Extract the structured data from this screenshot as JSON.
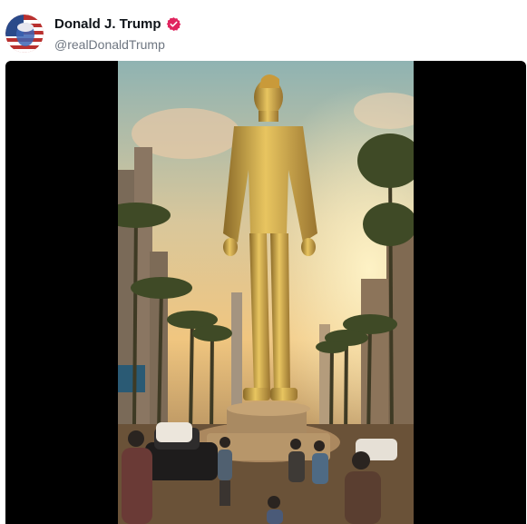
{
  "post": {
    "display_name": "Donald J. Trump",
    "handle": "@realDonaldTrump",
    "verified_icon": "verified-badge-icon",
    "avatar_icon": "avatar-flag-portrait"
  },
  "media": {
    "type": "video",
    "scene_icon": "golden-statue-video-frame"
  },
  "colors": {
    "verified": "#e0245e",
    "name": "#0f1419",
    "handle": "#6e7681",
    "media_background": "#000000",
    "accent_dot": "#e8167f"
  }
}
